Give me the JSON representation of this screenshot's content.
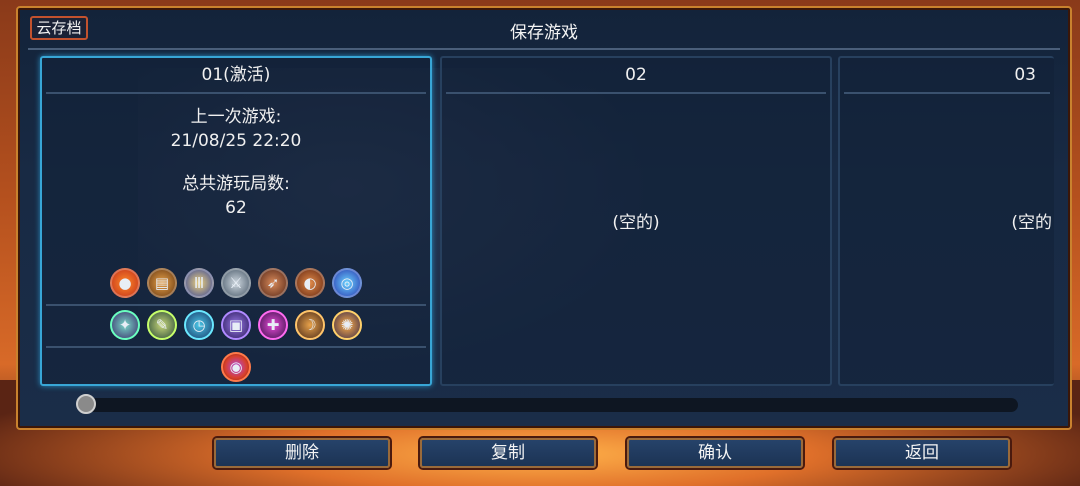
{
  "header": {
    "cloud_label": "云存档",
    "title": "保存游戏"
  },
  "slots": [
    {
      "name": "01(激活)",
      "last_played_label": "上一次游戏:",
      "last_played_value": "21/08/25  22:20",
      "total_runs_label": "总共游玩局数:",
      "total_runs_value": "62"
    },
    {
      "name": "02",
      "empty_label": "(空的)"
    },
    {
      "name": "03",
      "empty_label": "(空的"
    }
  ],
  "slot1_icons": {
    "row1": [
      "potion-bag-icon",
      "treasure-chest-icon",
      "scroll-icon",
      "dagger-dice-icon",
      "bow-dice-icon",
      "shield-dice-icon",
      "blue-orb-icon"
    ],
    "row2": [
      "green-rune-icon",
      "wrench-rune-icon",
      "teal-rune-icon",
      "purple-box-rune-icon",
      "purple-flame-icon",
      "horn-icon",
      "spider-rune-icon"
    ],
    "row3": [
      "eye-orb-icon"
    ]
  },
  "slider": {
    "value": 0
  },
  "buttons": {
    "delete": "删除",
    "copy": "复制",
    "confirm": "确认",
    "back": "返回"
  }
}
